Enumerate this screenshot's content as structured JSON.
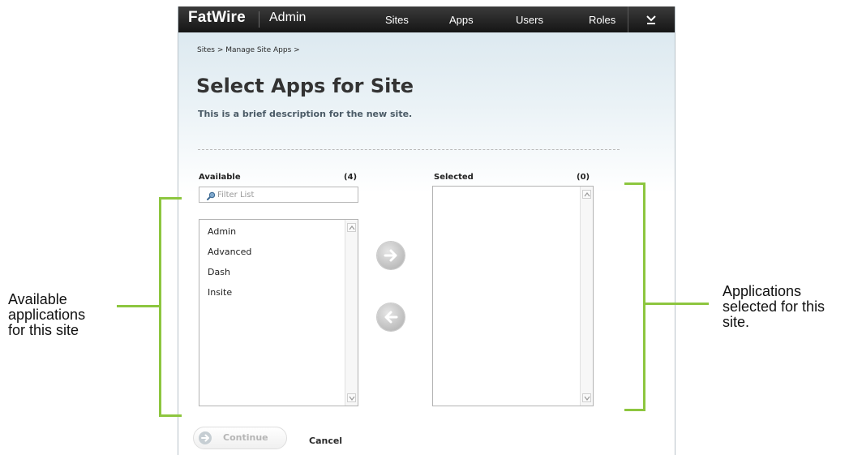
{
  "topbar": {
    "brand": "FatWire",
    "app_name": "Admin",
    "nav": [
      "Sites",
      "Apps",
      "Users",
      "Roles"
    ],
    "menu_icon": "chevron-down-icon"
  },
  "breadcrumb": "Sites > Manage Site Apps >",
  "page": {
    "title": "Select Apps for Site",
    "description": "This is a brief description for the new site."
  },
  "available": {
    "label": "Available",
    "count": "(4)",
    "filter_placeholder": "Filter List",
    "items": [
      "Admin",
      "Advanced",
      "Dash",
      "Insite"
    ]
  },
  "selected": {
    "label": "Selected",
    "count": "(0)",
    "items": []
  },
  "icons": {
    "filter": "search-icon",
    "add": "arrow-right-icon",
    "remove": "arrow-left-icon",
    "continue": "arrow-right-icon"
  },
  "footer": {
    "continue_label": "Continue",
    "cancel_label": "Cancel"
  },
  "annotations": {
    "left": [
      "Available",
      "applications",
      "for this site"
    ],
    "right": [
      "Applications",
      "selected for this",
      "site."
    ]
  },
  "colors": {
    "accent": "#8dc63f",
    "topbar": "#1f1f1f"
  }
}
